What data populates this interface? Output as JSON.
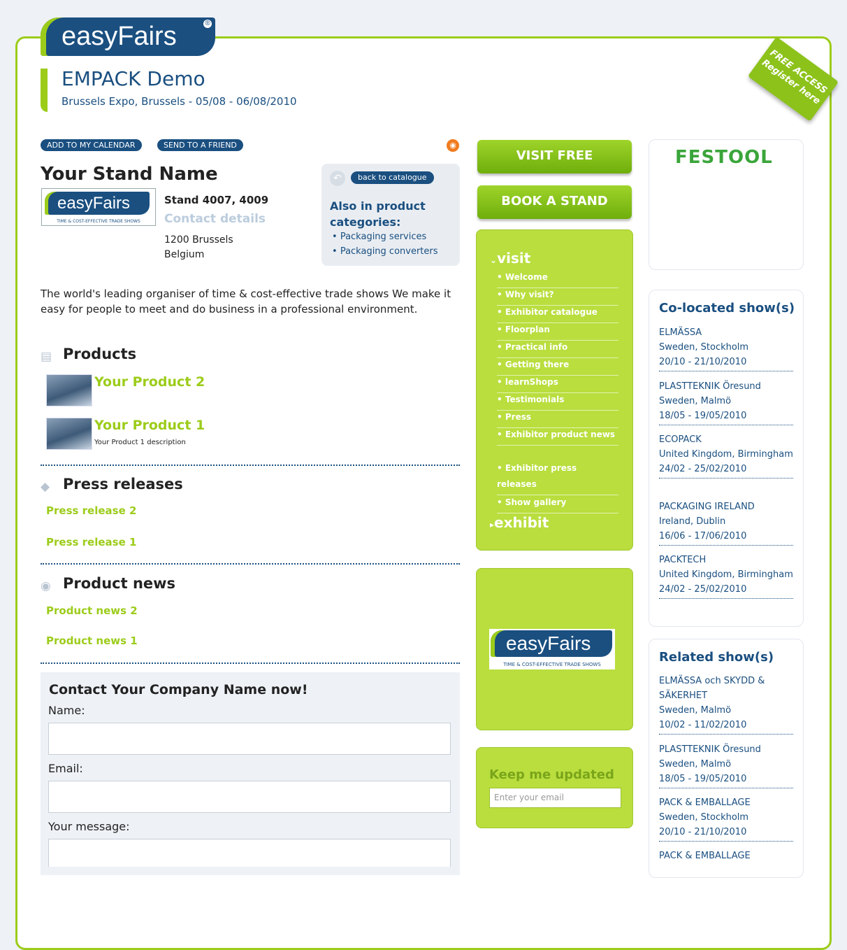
{
  "header": {
    "logo_text": "easyFairs",
    "logo_mark": "®",
    "event_title": "EMPACK Demo",
    "event_sub": "Brussels Expo, Brussels - 05/08 - 06/08/2010",
    "free_access_line1": "FREE ACCESS",
    "free_access_line2": "Register here"
  },
  "actions": {
    "add_calendar": "ADD TO MY CALENDAR",
    "send_friend": "SEND TO A FRIEND"
  },
  "stand": {
    "name": "Your Stand Name",
    "logo_text": "easyFairs",
    "logo_tag": "TIME & COST-EFFECTIVE TRADE SHOWS",
    "number": "Stand 4007, 4009",
    "contact_details": "Contact details",
    "addr1": "1200 Brussels",
    "addr2": "Belgium",
    "description": "The world's leading organiser of time & cost-effective trade shows We make it easy for people to meet and do business in a professional environment."
  },
  "categories": {
    "back": "back to catalogue",
    "title": "Also in product categories:",
    "items": [
      "Packaging services",
      "Packaging converters"
    ]
  },
  "products": {
    "heading": "Products",
    "items": [
      {
        "name": "Your Product 2",
        "desc": ""
      },
      {
        "name": "Your Product 1",
        "desc": "Your Product 1 description"
      }
    ]
  },
  "press": {
    "heading": "Press releases",
    "items": [
      "Press release 2",
      "Press release 1"
    ]
  },
  "news": {
    "heading": "Product news",
    "items": [
      "Product news 2",
      "Product news 1"
    ]
  },
  "contact_form": {
    "title": "Contact Your Company Name now!",
    "name_label": "Name:",
    "email_label": "Email:",
    "message_label": "Your message:"
  },
  "nav": {
    "visit_free": "VISIT FREE",
    "book_stand": "BOOK A STAND",
    "visit_head": "visit",
    "exhibit_head": "exhibit",
    "items": [
      "Welcome",
      "Why visit?",
      "Exhibitor catalogue",
      "Floorplan",
      "Practical info",
      "Getting there",
      "learnShops",
      "Testimonials",
      "Press",
      "Exhibitor product news",
      "Exhibitor press releases",
      "Show gallery"
    ]
  },
  "promo": {
    "logo_text": "easyFairs",
    "logo_tag": "TIME & COST-EFFECTIVE TRADE SHOWS"
  },
  "newsletter": {
    "title": "Keep me updated",
    "placeholder": "Enter your email"
  },
  "sponsor": {
    "name": "FESTOOL"
  },
  "colocated": {
    "title": "Co-located show(s)",
    "shows": [
      {
        "name": "ELMÄSSA",
        "loc": "Sweden, Stockholm",
        "dates": "20/10 - 21/10/2010"
      },
      {
        "name": "PLASTTEKNIK Öresund",
        "loc": "Sweden, Malmö",
        "dates": "18/05 - 19/05/2010"
      },
      {
        "name": "ECOPACK",
        "loc": "United Kingdom, Birmingham",
        "dates": "24/02 - 25/02/2010"
      },
      {
        "name": "PACKAGING IRELAND",
        "loc": "Ireland, Dublin",
        "dates": "16/06 - 17/06/2010"
      },
      {
        "name": "PACKTECH",
        "loc": "United Kingdom, Birmingham",
        "dates": "24/02 - 25/02/2010"
      }
    ]
  },
  "related": {
    "title": "Related show(s)",
    "shows": [
      {
        "name": "ELMÄSSA och SKYDD & SÄKERHET",
        "loc": "Sweden, Malmö",
        "dates": "10/02 - 11/02/2010"
      },
      {
        "name": "PLASTTEKNIK Öresund",
        "loc": "Sweden, Malmö",
        "dates": "18/05 - 19/05/2010"
      },
      {
        "name": "PACK & EMBALLAGE",
        "loc": "Sweden, Stockholm",
        "dates": "20/10 - 21/10/2010"
      },
      {
        "name": "PACK & EMBALLAGE",
        "loc": "",
        "dates": ""
      }
    ]
  },
  "colors": {
    "brand_blue": "#1a4f80",
    "brand_green": "#9ccc1a"
  }
}
